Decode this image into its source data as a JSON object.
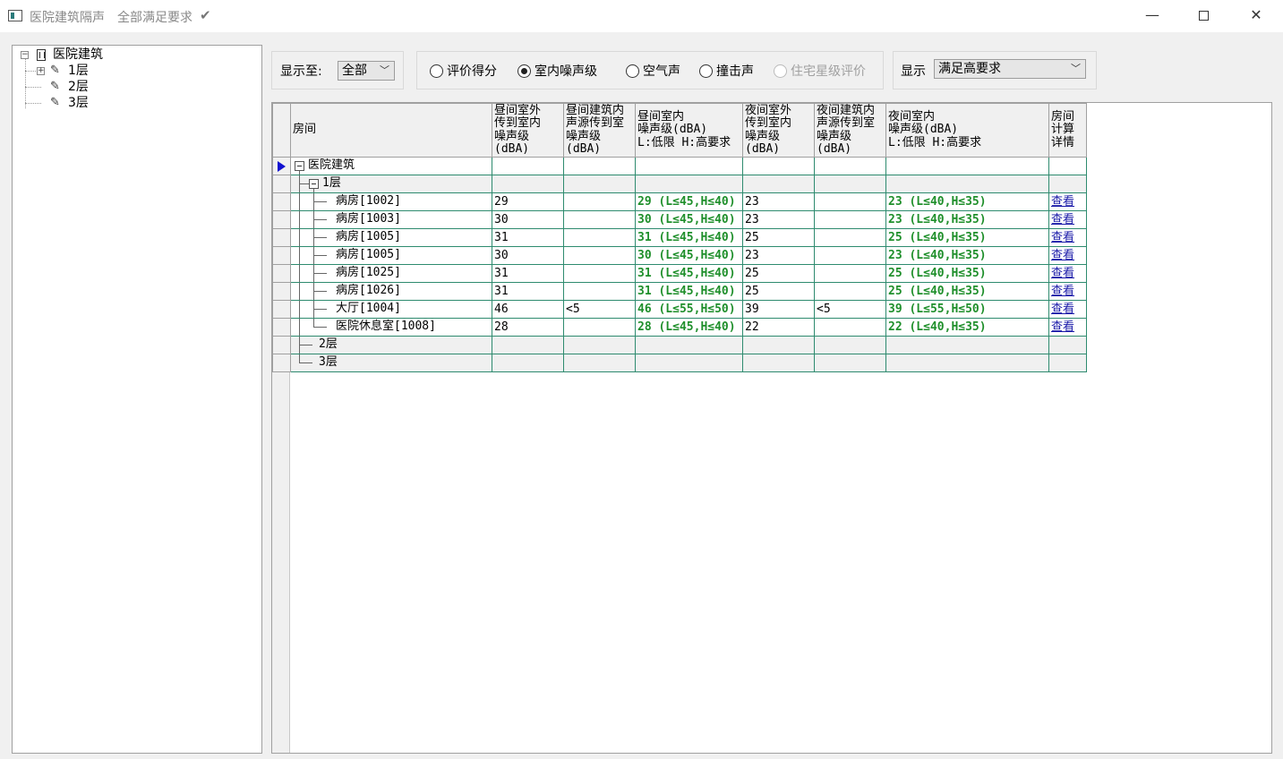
{
  "window": {
    "title": "医院建筑隔声",
    "status": "全部满足要求",
    "status_icon": "check-icon",
    "controls": {
      "minimize": "—",
      "close": "✕"
    }
  },
  "tree": {
    "root": "医院建筑",
    "floors": [
      "1层",
      "2层",
      "3层"
    ]
  },
  "toolbar": {
    "display_to_label": "显示至:",
    "display_to_value": "全部",
    "radios": [
      {
        "label": "评价得分",
        "selected": false,
        "enabled": true
      },
      {
        "label": "室内噪声级",
        "selected": true,
        "enabled": true
      },
      {
        "label": "空气声",
        "selected": false,
        "enabled": true
      },
      {
        "label": "撞击声",
        "selected": false,
        "enabled": true
      },
      {
        "label": "住宅星级评价",
        "selected": false,
        "enabled": false
      }
    ],
    "show_label": "显示",
    "show_value": "满足高要求"
  },
  "grid": {
    "columns": [
      "房间",
      "昼间室外\n传到室内\n噪声级(dBA)",
      "昼间建筑内\n声源传到室\n噪声级(dBA)",
      "昼间室内\n噪声级(dBA)\nL:低限 H:高要求",
      "夜间室外\n传到室内\n噪声级(dBA)",
      "夜间建筑内\n声源传到室\n噪声级(dBA)",
      "夜间室内\n噪声级(dBA)\nL:低限 H:高要求",
      "房间\n计算\n详情"
    ],
    "root_row": "医院建筑",
    "floor1": "1层",
    "rooms": [
      {
        "name": "病房[1002]",
        "day_out": "29",
        "day_in_src": "",
        "day_total": "29 (L≤45,H≤40)",
        "night_out": "23",
        "night_in_src": "",
        "night_total": "23 (L≤40,H≤35)",
        "detail": "查看"
      },
      {
        "name": "病房[1003]",
        "day_out": "30",
        "day_in_src": "",
        "day_total": "30 (L≤45,H≤40)",
        "night_out": "23",
        "night_in_src": "",
        "night_total": "23 (L≤40,H≤35)",
        "detail": "查看"
      },
      {
        "name": "病房[1005]",
        "day_out": "31",
        "day_in_src": "",
        "day_total": "31 (L≤45,H≤40)",
        "night_out": "25",
        "night_in_src": "",
        "night_total": "25 (L≤40,H≤35)",
        "detail": "查看"
      },
      {
        "name": "病房[1005]",
        "day_out": "30",
        "day_in_src": "",
        "day_total": "30 (L≤45,H≤40)",
        "night_out": "23",
        "night_in_src": "",
        "night_total": "23 (L≤40,H≤35)",
        "detail": "查看"
      },
      {
        "name": "病房[1025]",
        "day_out": "31",
        "day_in_src": "",
        "day_total": "31 (L≤45,H≤40)",
        "night_out": "25",
        "night_in_src": "",
        "night_total": "25 (L≤40,H≤35)",
        "detail": "查看"
      },
      {
        "name": "病房[1026]",
        "day_out": "31",
        "day_in_src": "",
        "day_total": "31 (L≤45,H≤40)",
        "night_out": "25",
        "night_in_src": "",
        "night_total": "25 (L≤40,H≤35)",
        "detail": "查看"
      },
      {
        "name": "大厅[1004]",
        "day_out": "46",
        "day_in_src": "<5",
        "day_total": "46 (L≤55,H≤50)",
        "night_out": "39",
        "night_in_src": "<5",
        "night_total": "39 (L≤55,H≤50)",
        "detail": "查看"
      },
      {
        "name": "医院休息室[1008]",
        "day_out": "28",
        "day_in_src": "",
        "day_total": "28 (L≤45,H≤40)",
        "night_out": "22",
        "night_in_src": "",
        "night_total": "22 (L≤40,H≤35)",
        "detail": "查看"
      }
    ],
    "floor2": "2层",
    "floor3": "3层"
  },
  "colors": {
    "ok_green": "#1f8f2b",
    "link_blue": "#1a1aa8",
    "grid_line": "#2e8b6f",
    "pointer": "#1010d0"
  }
}
